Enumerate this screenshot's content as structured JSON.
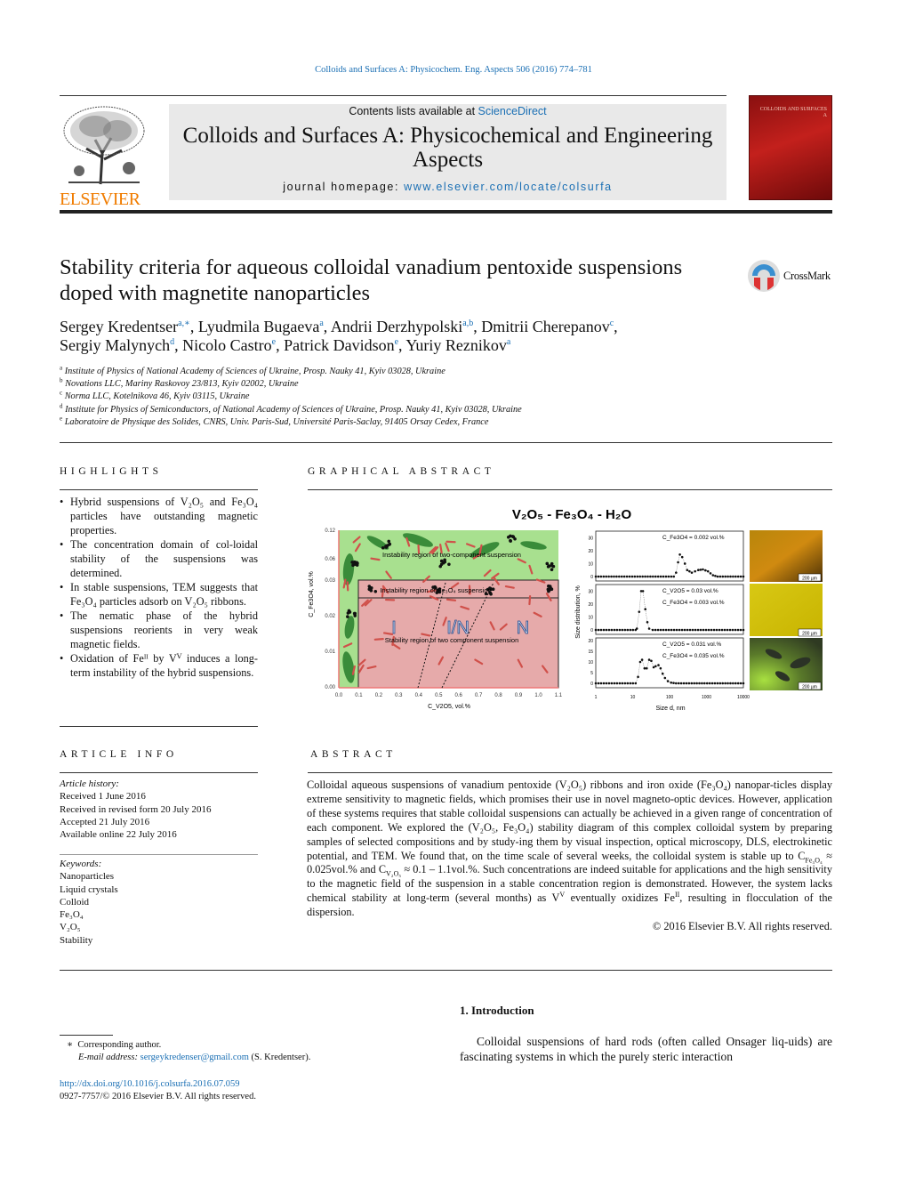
{
  "journal_ref": "Colloids and Surfaces A: Physicochem. Eng. Aspects 506 (2016) 774–781",
  "header": {
    "contents_prefix": "Contents lists available at ",
    "contents_link": "ScienceDirect",
    "journal_title": "Colloids and Surfaces A: Physicochemical and Engineering Aspects",
    "homepage_prefix": "journal homepage: ",
    "homepage_link": "www.elsevier.com/locate/colsurfa",
    "publisher_logo": "ELSEVIER",
    "cover_text": "COLLOIDS AND SURFACES A"
  },
  "crossmark": "CrossMark",
  "title": "Stability criteria for aqueous colloidal vanadium pentoxide suspensions doped with magnetite nanoparticles",
  "authors": [
    {
      "name": "Sergey Kredentser",
      "sup": "a,∗"
    },
    {
      "name": "Lyudmila Bugaeva",
      "sup": "a"
    },
    {
      "name": "Andrii Derzhypolski",
      "sup": "a,b"
    },
    {
      "name": "Dmitrii Cherepanov",
      "sup": "c"
    },
    {
      "name": "Sergiy Malynych",
      "sup": "d"
    },
    {
      "name": "Nicolo Castro",
      "sup": "e"
    },
    {
      "name": "Patrick Davidson",
      "sup": "e"
    },
    {
      "name": "Yuriy Reznikov",
      "sup": "a"
    }
  ],
  "affiliations": [
    {
      "mark": "a",
      "text": "Institute of Physics of National Academy of Sciences of Ukraine, Prosp. Nauky 41, Kyiv 03028, Ukraine"
    },
    {
      "mark": "b",
      "text": "Novations LLC, Mariny Raskovoy 23/813, Kyiv 02002, Ukraine"
    },
    {
      "mark": "c",
      "text": "Norma LLC, Kotelnikova 46, Kyiv 03115, Ukraine"
    },
    {
      "mark": "d",
      "text": "Institute for Physics of Semiconductors, of National Academy of Sciences of Ukraine, Prosp. Nauky 41, Kyiv 03028, Ukraine"
    },
    {
      "mark": "e",
      "text": "Laboratoire de Physique des Solides, CNRS, Univ. Paris-Sud, Université Paris-Saclay, 91405 Orsay Cedex, France"
    }
  ],
  "highlights": {
    "heading": "HIGHLIGHTS",
    "items": [
      "Hybrid suspensions of V₂O₅ and Fe₃O₄ particles have outstanding magnetic properties.",
      "The concentration domain of col-loidal stability of the suspensions was determined.",
      "In stable suspensions, TEM suggests that Fe₃O₄ particles adsorb on V₂O₅ ribbons.",
      "The nematic phase of the hybrid suspensions reorients in very weak magnetic fields.",
      "Oxidation of Feᴵᴵ by Vⱽ induces a long-term instability of the hybrid suspensions."
    ]
  },
  "graphical_abstract": {
    "heading": "GRAPHICAL ABSTRACT",
    "figure_title": "V₂O₅ - Fe₃O₄ - H₂O",
    "diagram": {
      "region_top": "Instability region of two-component suspension",
      "region_fe": "Instability region of Fe₃O₄ suspension",
      "region_stable": "Stability region of two component suspension",
      "phases": [
        "I",
        "I/N",
        "N"
      ],
      "ylabel": "C_Fe3O4, vol.%",
      "xlabel": "C_V2O5, vol.%",
      "yticks": [
        "0.12",
        "0.06",
        "0.03",
        "0.02",
        "0.01",
        "0.00"
      ],
      "xticks": [
        "0.0",
        "0.1",
        "0.2",
        "0.3",
        "0.4",
        "0.5",
        "0.6",
        "0.7",
        "0.8",
        "0.9",
        "1.0",
        "1.1"
      ],
      "colors": {
        "unstable": "#a8e08f",
        "stable": "#e6aaaa",
        "ribbon": "#d0504a",
        "droplet": "#3a8c3a"
      }
    },
    "dls": {
      "ylabel": "Size distribution, %",
      "xlabel": "Size d, nm",
      "xticks": [
        "1",
        "10",
        "100",
        "1000",
        "10000"
      ],
      "panels": [
        {
          "labels": [
            "C_Fe3O4 = 0.002 vol.%"
          ],
          "yticks": [
            0,
            10,
            20,
            30
          ],
          "ymax": 33,
          "points": [
            [
              1,
              0
            ],
            [
              130,
              0
            ],
            [
              150,
              3
            ],
            [
              170,
              11
            ],
            [
              190,
              17
            ],
            [
              220,
              15
            ],
            [
              260,
              10
            ],
            [
              300,
              5
            ],
            [
              400,
              3
            ],
            [
              600,
              5
            ],
            [
              800,
              5.5
            ],
            [
              1100,
              4
            ],
            [
              1500,
              1
            ],
            [
              2000,
              0
            ],
            [
              10000,
              0
            ]
          ]
        },
        {
          "labels": [
            "C_V2O5 = 0.03 vol.%",
            "C_Fe3O4 = 0.003 vol.%"
          ],
          "yticks": [
            0,
            10,
            20,
            30
          ],
          "ymax": 33,
          "points": [
            [
              1,
              0
            ],
            [
              12,
              0
            ],
            [
              13,
              1
            ],
            [
              15,
              14
            ],
            [
              17,
              30
            ],
            [
              19,
              30
            ],
            [
              22,
              16
            ],
            [
              25,
              6
            ],
            [
              28,
              1
            ],
            [
              35,
              0
            ],
            [
              10000,
              0
            ]
          ]
        },
        {
          "labels": [
            "C_V2O5 = 0.031 vol.%",
            "C_Fe3O4 = 0.035 vol.%"
          ],
          "yticks": [
            0,
            5,
            10,
            15,
            20
          ],
          "ymax": 20,
          "points": [
            [
              1,
              0
            ],
            [
              12,
              0
            ],
            [
              14,
              3
            ],
            [
              16,
              10
            ],
            [
              18,
              11
            ],
            [
              21,
              7
            ],
            [
              24,
              7
            ],
            [
              28,
              11
            ],
            [
              32,
              10.5
            ],
            [
              37,
              7.5
            ],
            [
              42,
              8
            ],
            [
              50,
              8.5
            ],
            [
              57,
              7
            ],
            [
              65,
              4.5
            ],
            [
              75,
              2.5
            ],
            [
              90,
              1
            ],
            [
              110,
              0.3
            ],
            [
              150,
              0
            ],
            [
              10000,
              0
            ]
          ]
        }
      ],
      "scale_bar": "200 µm"
    }
  },
  "article_info": {
    "heading": "ARTICLE INFO",
    "history_label": "Article history:",
    "history": [
      "Received 1 June 2016",
      "Received in revised form 20 July 2016",
      "Accepted 21 July 2016",
      "Available online 22 July 2016"
    ],
    "keywords_label": "Keywords:",
    "keywords": [
      "Nanoparticles",
      "Liquid crystals",
      "Colloid",
      "Fe₃O₄",
      "V₂O₅",
      "Stability"
    ]
  },
  "abstract": {
    "heading": "ABSTRACT",
    "p1": "Colloidal aqueous suspensions of vanadium pentoxide (V₂O₅) ribbons and iron oxide (Fe₃O₄) nanopar-ticles display extreme sensitivity to magnetic fields, which promises their use in novel magneto-optic devices. However, application of these systems requires that stable colloidal suspensions can actually be achieved in a given range of concentration of each component. We explored the (V₂O₅, Fe₃O₄) stability diagram of this complex colloidal system by preparing samples of selected compositions and by study-ing them by visual inspection, optical microscopy, DLS, electrokinetic potential, and TEM. We found that, on the time scale of several weeks, the colloidal system is stable up to C",
    "sub1": "Fe₃O₄",
    "p2": " ≈ 0.025vol.% and C",
    "sub2": "V₂O₅",
    "p3": " ≈ 0.1 – 1.1vol.%. Such concentrations are indeed suitable for applications and the high sensitivity to the magnetic field of the suspension in a stable concentration region is demonstrated. However, the system lacks chemical stability at long-term (several months) as V",
    "sup1": "V",
    "p4": " eventually oxidizes Fe",
    "sup2": "II",
    "p5": ", resulting in flocculation of the dispersion.",
    "copyright": "© 2016 Elsevier B.V. All rights reserved."
  },
  "introduction": {
    "heading": "1.  Introduction",
    "text": "Colloidal suspensions of hard rods (often called Onsager liq-uids) are fascinating systems in which the purely steric interaction"
  },
  "footnote": {
    "mark": "∗",
    "corresponding": "Corresponding author.",
    "email_label": "E-mail address: ",
    "email": "sergeykredenser@gmail.com",
    "email_owner": " (S. Kredentser).",
    "doi": "http://dx.doi.org/10.1016/j.colsurfa.2016.07.059",
    "issn": "0927-7757/© 2016 Elsevier B.V. All rights reserved."
  }
}
